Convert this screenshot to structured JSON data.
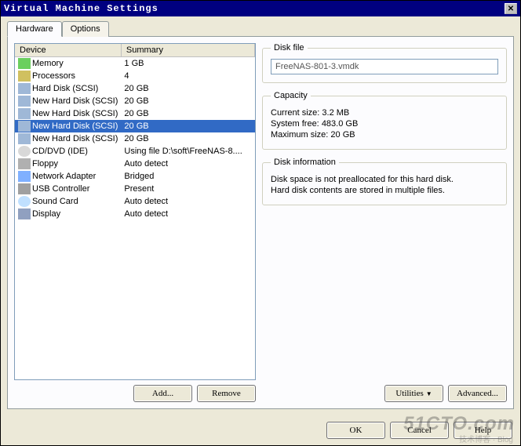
{
  "window": {
    "title": "Virtual Machine Settings"
  },
  "tabs": {
    "hardware": "Hardware",
    "options": "Options"
  },
  "table": {
    "headers": {
      "device": "Device",
      "summary": "Summary"
    },
    "rows": [
      {
        "icon": "memory-icon",
        "name": "Memory",
        "summary": "1 GB",
        "ic": "ic-mem"
      },
      {
        "icon": "cpu-icon",
        "name": "Processors",
        "summary": "4",
        "ic": "ic-cpu"
      },
      {
        "icon": "harddisk-icon",
        "name": "Hard Disk (SCSI)",
        "summary": "20 GB",
        "ic": "ic-hd"
      },
      {
        "icon": "harddisk-icon",
        "name": "New Hard Disk (SCSI)",
        "summary": "20 GB",
        "ic": "ic-hd"
      },
      {
        "icon": "harddisk-icon",
        "name": "New Hard Disk (SCSI)",
        "summary": "20 GB",
        "ic": "ic-hd"
      },
      {
        "icon": "harddisk-icon",
        "name": "New Hard Disk (SCSI)",
        "summary": "20 GB",
        "ic": "ic-hd",
        "selected": true
      },
      {
        "icon": "harddisk-icon",
        "name": "New Hard Disk (SCSI)",
        "summary": "20 GB",
        "ic": "ic-hd"
      },
      {
        "icon": "cd-icon",
        "name": "CD/DVD (IDE)",
        "summary": "Using file D:\\soft\\FreeNAS-8....",
        "ic": "ic-cd"
      },
      {
        "icon": "floppy-icon",
        "name": "Floppy",
        "summary": "Auto detect",
        "ic": "ic-fd"
      },
      {
        "icon": "network-icon",
        "name": "Network Adapter",
        "summary": "Bridged",
        "ic": "ic-net"
      },
      {
        "icon": "usb-icon",
        "name": "USB Controller",
        "summary": "Present",
        "ic": "ic-usb"
      },
      {
        "icon": "sound-icon",
        "name": "Sound Card",
        "summary": "Auto detect",
        "ic": "ic-snd"
      },
      {
        "icon": "display-icon",
        "name": "Display",
        "summary": "Auto detect",
        "ic": "ic-disp"
      }
    ]
  },
  "left_buttons": {
    "add": "Add...",
    "remove": "Remove"
  },
  "diskfile": {
    "legend": "Disk file",
    "value": "FreeNAS-801-3.vmdk"
  },
  "capacity": {
    "legend": "Capacity",
    "current_label": "Current size:",
    "current_value": "3.2 MB",
    "sysfree_label": "System free:",
    "sysfree_value": "483.0 GB",
    "max_label": "Maximum size:",
    "max_value": "20 GB"
  },
  "diskinfo": {
    "legend": "Disk information",
    "line1": "Disk space is not preallocated for this hard disk.",
    "line2": "Hard disk contents are stored in multiple files."
  },
  "right_buttons": {
    "utilities": "Utilities",
    "advanced": "Advanced..."
  },
  "bottom_buttons": {
    "ok": "OK",
    "cancel": "Cancel",
    "help": "Help"
  },
  "watermark": {
    "main": "51CTO.com",
    "sub": "技术博客 · Blog"
  }
}
